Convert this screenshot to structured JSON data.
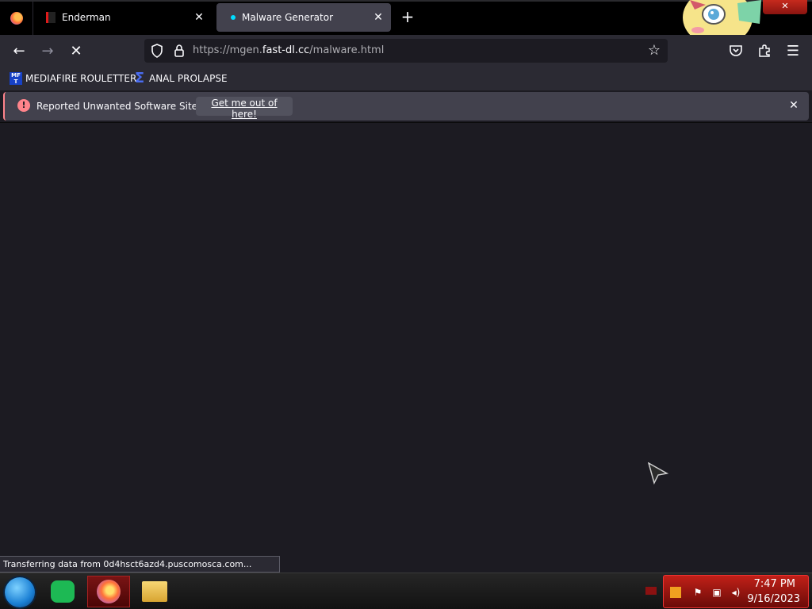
{
  "tabs": [
    {
      "title": "Enderman",
      "active": false
    },
    {
      "title": "Malware Generator",
      "active": true
    }
  ],
  "urlbar": {
    "prefix": "https://mgen.",
    "host": "fast-dl.cc",
    "path": "/malware.html"
  },
  "bookmarks": [
    {
      "label": "MEDIAFIRE ROULETTER",
      "icon": "mediafire-icon",
      "icon_text": "MF T"
    },
    {
      "label": "ANAL PROLAPSE",
      "icon": "sigma-icon",
      "icon_text": "Σ"
    }
  ],
  "notification": {
    "message": "Reported Unwanted Software Site!",
    "action_label": "Get me out of here!"
  },
  "status": {
    "text": "Transferring data from 0d4hsct6azd4.puscomosca.com..."
  },
  "taskbar": {
    "apps": [
      "start-orb",
      "notes-app",
      "firefox",
      "file-explorer"
    ],
    "time": "7:47 PM",
    "date": "9/16/2023"
  },
  "colors": {
    "content_bg": "#1c1b22",
    "toolbar_bg": "#2b2a33",
    "active_tab_bg": "#42414d",
    "warning": "#ff848b",
    "tray_red": "#c12018"
  }
}
